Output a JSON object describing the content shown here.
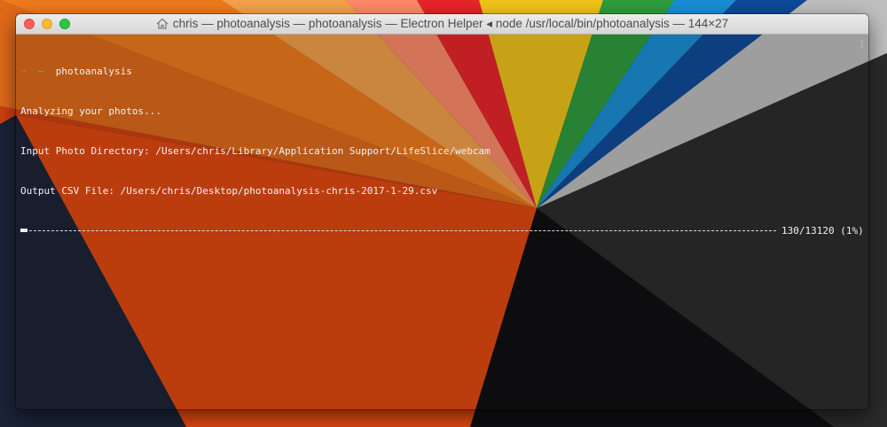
{
  "window": {
    "title": "chris — photoanalysis — photoanalysis — Electron Helper ◂ node /usr/local/bin/photoanalysis — 144×27"
  },
  "terminal": {
    "prompt_arrow": "➜",
    "prompt_dir": "~",
    "command": "photoanalysis",
    "output": [
      "Analyzing your photos...",
      "Input Photo Directory: /Users/chris/Library/Application Support/LifeSlice/webcam",
      "Output CSV File: /Users/chris/Desktop/photoanalysis-chris-2017-1-29.csv"
    ],
    "progress": {
      "current": 130,
      "total": 13120,
      "fraction": 0.0099,
      "label": "130/13120 (1%)"
    },
    "scroll_bracket": "]"
  },
  "colors": {
    "prompt_arrow": "#e05a3a",
    "prompt_dir": "#3ac7d2",
    "text": "#f2f2f2"
  },
  "icons": {
    "title": "home-icon"
  }
}
